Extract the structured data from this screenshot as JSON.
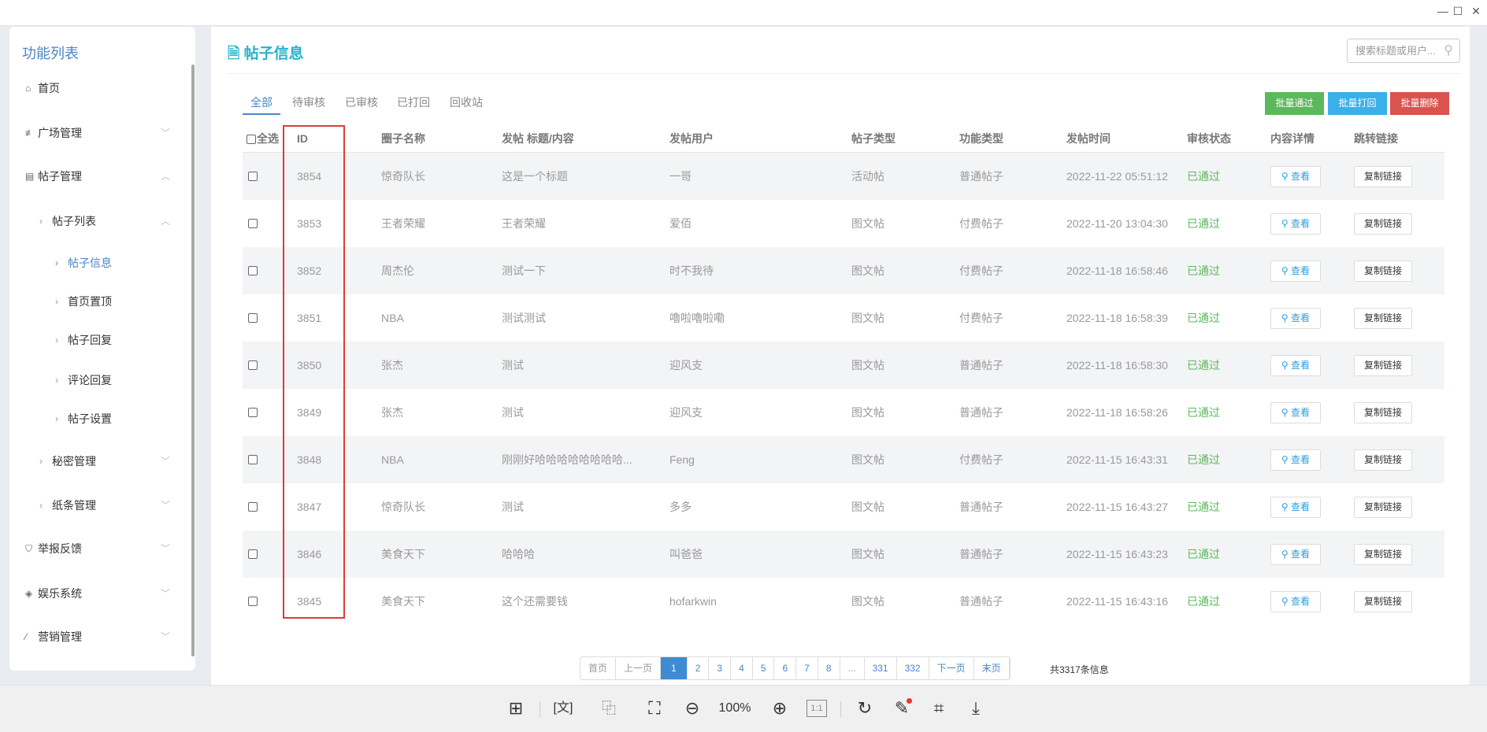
{
  "window": {
    "minimize": "—",
    "maximize": "☐",
    "close": "✕"
  },
  "sidebar": {
    "title": "功能列表",
    "items": [
      {
        "label": "首页",
        "icon": "home-icon"
      },
      {
        "label": "广场管理",
        "icon": "sliders-icon"
      },
      {
        "label": "帖子管理",
        "icon": "document-icon"
      },
      {
        "label": "帖子列表"
      },
      {
        "label": "帖子信息",
        "active": true
      },
      {
        "label": "首页置顶"
      },
      {
        "label": "帖子回复"
      },
      {
        "label": "评论回复"
      },
      {
        "label": "帖子设置"
      },
      {
        "label": "秘密管理"
      },
      {
        "label": "纸条管理"
      },
      {
        "label": "举报反馈",
        "icon": "shield-icon"
      },
      {
        "label": "娱乐系统",
        "icon": "tags-icon"
      },
      {
        "label": "营销管理",
        "icon": "magic-wand-icon"
      }
    ]
  },
  "header": {
    "title": "帖子信息",
    "search_placeholder": "搜索标题或用户..."
  },
  "tabs": [
    "全部",
    "待审核",
    "已审核",
    "已打回",
    "回收站"
  ],
  "actions": {
    "approve": "批量通过",
    "reject": "批量打回",
    "delete": "批量删除"
  },
  "colors": {
    "approve": "#5cb85c",
    "reject": "#3bafe9",
    "delete": "#d9534f",
    "accent": "#4a86c5",
    "title": "#26b3c9"
  },
  "table": {
    "headers": [
      "全选",
      "ID",
      "圈子名称",
      "发帖 标题/内容",
      "发帖用户",
      "帖子类型",
      "功能类型",
      "发帖时间",
      "审核状态",
      "内容详情",
      "跳转链接"
    ],
    "view_label": "查看",
    "copy_label": "复制链接",
    "rows": [
      [
        "3854",
        "惊奇队长",
        "这是一个标题",
        "一哥",
        "活动帖",
        "普通帖子",
        "2022-11-22 05:51:12",
        "已通过"
      ],
      [
        "3853",
        "王者荣耀",
        "王者荣耀",
        "爱佰",
        "图文帖",
        "付费帖子",
        "2022-11-20 13:04:30",
        "已通过"
      ],
      [
        "3852",
        "周杰伦",
        "测试一下",
        "时不我待",
        "图文帖",
        "付费帖子",
        "2022-11-18 16:58:46",
        "已通过"
      ],
      [
        "3851",
        "NBA",
        "测试测试",
        "嚕啦嚕啦嘞",
        "图文帖",
        "付费帖子",
        "2022-11-18 16:58:39",
        "已通过"
      ],
      [
        "3850",
        "张杰",
        "测试",
        "迎风支",
        "图文帖",
        "普通帖子",
        "2022-11-18 16:58:30",
        "已通过"
      ],
      [
        "3849",
        "张杰",
        "测试",
        "迎风支",
        "图文帖",
        "普通帖子",
        "2022-11-18 16:58:26",
        "已通过"
      ],
      [
        "3848",
        "NBA",
        "刚刚好哈哈哈哈哈哈哈哈...",
        "Feng",
        "图文帖",
        "付费帖子",
        "2022-11-15 16:43:31",
        "已通过"
      ],
      [
        "3847",
        "惊奇队长",
        "测试",
        "多多",
        "图文帖",
        "普通帖子",
        "2022-11-15 16:43:27",
        "已通过"
      ],
      [
        "3846",
        "美食天下",
        "哈哈哈",
        "叫爸爸",
        "图文帖",
        "普通帖子",
        "2022-11-15 16:43:23",
        "已通过"
      ],
      [
        "3845",
        "美食天下",
        "这个还需要钱",
        "hofarkwin",
        "图文帖",
        "普通帖子",
        "2022-11-15 16:43:16",
        "已通过"
      ]
    ]
  },
  "pagination": {
    "items": [
      "首页",
      "上一页",
      "1",
      "2",
      "3",
      "4",
      "5",
      "6",
      "7",
      "8",
      "...",
      "331",
      "332",
      "下一页",
      "末页"
    ],
    "current": "1",
    "total": "共3317条信息"
  },
  "viewer_toolbar": {
    "zoom": "100%",
    "actual_size": "1:1"
  }
}
